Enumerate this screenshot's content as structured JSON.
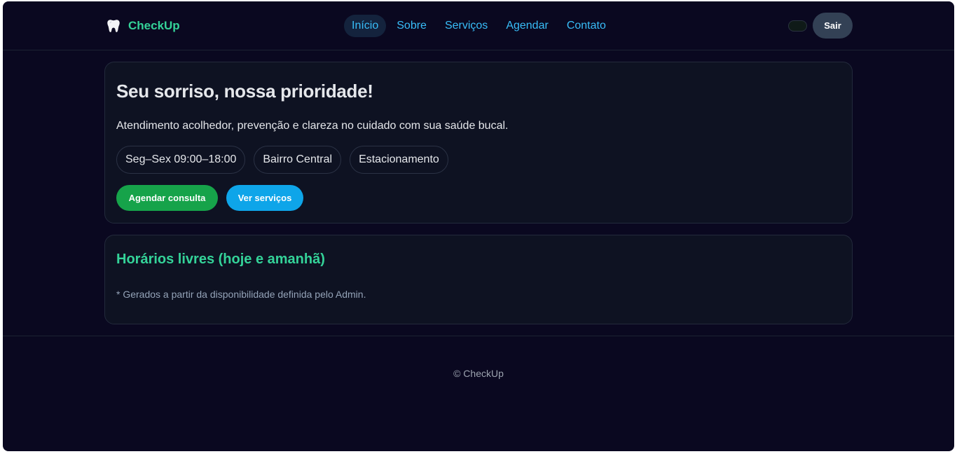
{
  "brand": {
    "name": "CheckUp",
    "icon": "tooth-icon"
  },
  "nav": {
    "items": [
      {
        "label": "Início",
        "active": true
      },
      {
        "label": "Sobre",
        "active": false
      },
      {
        "label": "Serviços",
        "active": false
      },
      {
        "label": "Agendar",
        "active": false
      },
      {
        "label": "Contato",
        "active": false
      }
    ]
  },
  "header": {
    "logout_label": "Sair"
  },
  "hero": {
    "title": "Seu sorriso, nossa prioridade!",
    "subtitle": "Atendimento acolhedor, prevenção e clareza no cuidado com sua saúde bucal.",
    "chips": [
      "Seg–Sex 09:00–18:00",
      "Bairro Central",
      "Estacionamento"
    ],
    "primary_cta": "Agendar consulta",
    "secondary_cta": "Ver serviços"
  },
  "slots": {
    "title": "Horários livres (hoje e amanhã)",
    "note": "* Gerados a partir da disponibilidade definida pelo Admin."
  },
  "footer": {
    "copyright": "© CheckUp"
  },
  "colors": {
    "background": "#0a0820",
    "card": "#0e1222",
    "brand_green": "#34d399",
    "link_blue": "#38bdf8",
    "button_green": "#16a34a",
    "button_blue": "#0ea5e9",
    "logout_button": "#334155"
  }
}
